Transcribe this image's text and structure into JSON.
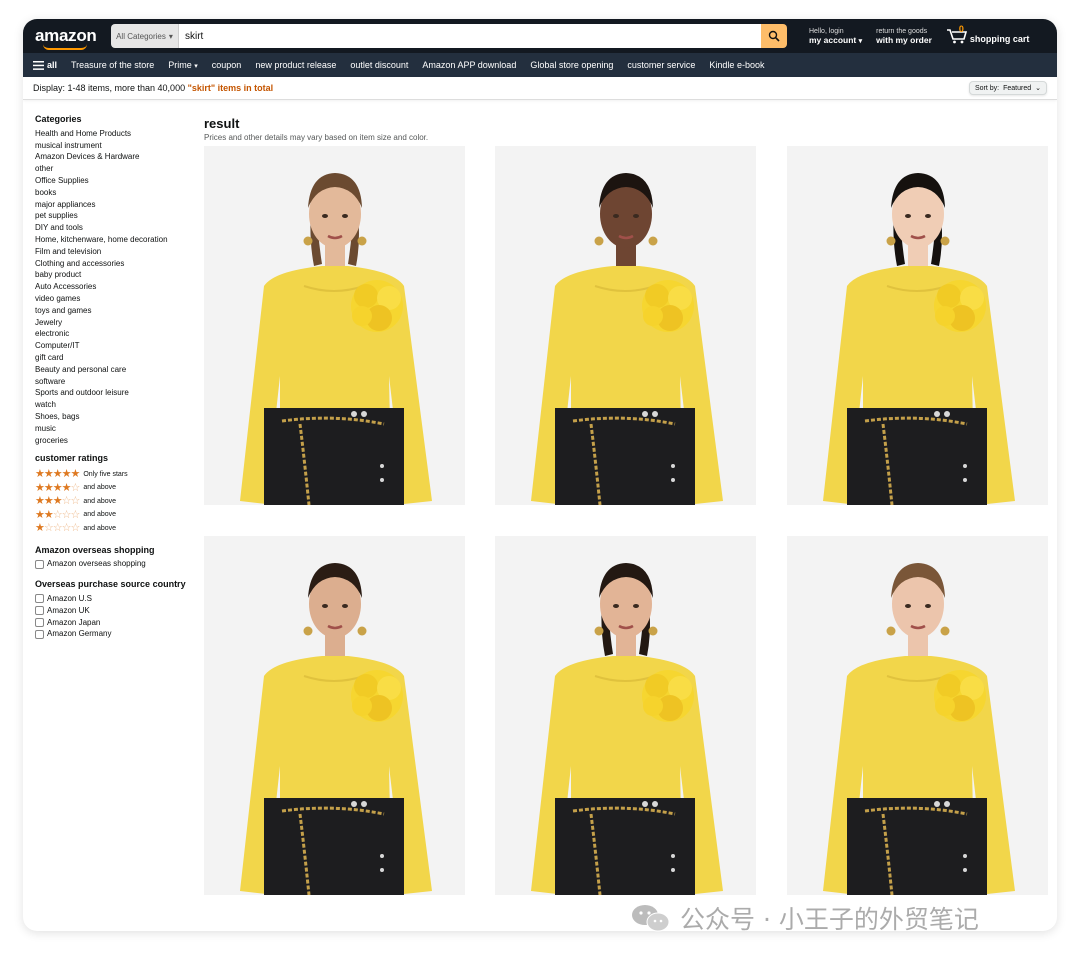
{
  "header": {
    "logo": "amazon",
    "search_category": "All Categories",
    "search_value": "skirt",
    "account_line1": "Hello, login",
    "account_line2": "my account",
    "orders_line1": "return the goods",
    "orders_line2": "with my order",
    "cart_count": "0",
    "cart_label": "shopping cart"
  },
  "nav": {
    "all_label": "all",
    "items": [
      "Treasure of the store",
      "Prime",
      "coupon",
      "new product release",
      "outlet discount",
      "Amazon APP download",
      "Global store opening",
      "customer service",
      "Kindle e-book"
    ]
  },
  "results_bar": {
    "prefix": "Display: 1-48 items, more than 40,000",
    "term": "\"skirt\" items in total",
    "sort_label": "Sort by:",
    "sort_value": "Featured"
  },
  "sidebar": {
    "categories_title": "Categories",
    "categories": [
      "Health and Home Products",
      "musical instrument",
      "Amazon Devices & Hardware",
      "other",
      "Office Supplies",
      "books",
      "major appliances",
      "pet supplies",
      "DIY and tools",
      "Home, kitchenware, home decoration",
      "Film and television",
      "Clothing and accessories",
      "baby product",
      "Auto Accessories",
      "video games",
      "toys and games",
      "Jewelry",
      "electronic",
      "Computer/IT",
      "gift card",
      "Beauty and personal care",
      "software",
      "Sports and outdoor leisure",
      "watch",
      "Shoes, bags",
      "music",
      "groceries"
    ],
    "ratings_title": "customer ratings",
    "ratings": [
      {
        "stars": 5,
        "label": "Only five stars"
      },
      {
        "stars": 4,
        "label": "and above"
      },
      {
        "stars": 3,
        "label": "and above"
      },
      {
        "stars": 2,
        "label": "and above"
      },
      {
        "stars": 1,
        "label": "and above"
      }
    ],
    "overseas_title": "Amazon overseas shopping",
    "overseas_option": "Amazon overseas shopping",
    "source_title": "Overseas purchase source country",
    "source_options": [
      "Amazon U.S",
      "Amazon UK",
      "Amazon Japan",
      "Amazon Germany"
    ]
  },
  "main": {
    "title": "result",
    "subtitle": "Prices and other details may vary based on item size and color.",
    "products": [
      {
        "hair": "#6b4a30",
        "skin": "#e3b99a",
        "long_hair": true
      },
      {
        "hair": "#1c1410",
        "skin": "#6e4532",
        "long_hair": false
      },
      {
        "hair": "#15110e",
        "skin": "#f0cdb5",
        "long_hair": true
      },
      {
        "hair": "#2a1c14",
        "skin": "#dcae8f",
        "long_hair": false
      },
      {
        "hair": "#231812",
        "skin": "#e2b496",
        "long_hair": true
      },
      {
        "hair": "#7a5638",
        "skin": "#ecc5ac",
        "long_hair": false
      }
    ]
  },
  "watermark": "公众号 · 小王子的外贸笔记",
  "colors": {
    "topbar": "#131921",
    "navbar": "#232f3e",
    "accent": "#febd69",
    "star": "#de7921",
    "top": "#f2d64a",
    "skirt": "#1d1d1f"
  }
}
